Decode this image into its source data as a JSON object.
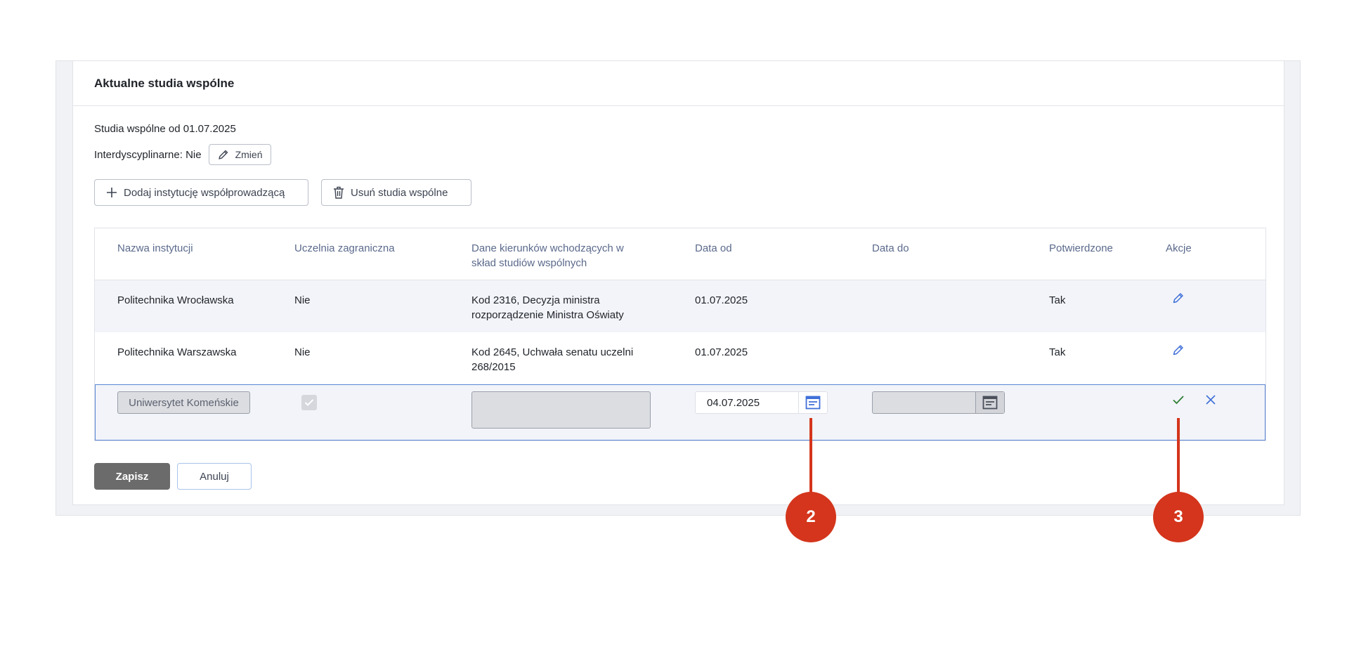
{
  "panel": {
    "title": "Aktualne studia wspólne",
    "since_text": "Studia wspólne od 01.07.2025",
    "interdisciplinary_label": "Interdyscyplinarne: Nie",
    "change_label": "Zmień"
  },
  "toolbar": {
    "add_institution_label": "Dodaj instytucję współprowadzącą",
    "delete_joint_label": "Usuń studia wspólne"
  },
  "table": {
    "headers": {
      "name": "Nazwa instytucji",
      "foreign": "Uczelnia zagraniczna",
      "programs_line1": "Dane kierunków wchodzących w",
      "programs_line2": "skład studiów wspólnych",
      "date_from": "Data od",
      "date_to": "Data do",
      "confirmed": "Potwierdzone",
      "actions": "Akcje"
    },
    "rows": [
      {
        "name": "Politechnika Wrocławska",
        "foreign": "Nie",
        "programs_line1": "Kod 2316, Decyzja ministra",
        "programs_line2": "rozporządzenie Ministra Oświaty",
        "date_from": "01.07.2025",
        "date_to": "",
        "confirmed": "Tak"
      },
      {
        "name": "Politechnika Warszawska",
        "foreign": "Nie",
        "programs_line1": "Kod 2645, Uchwała senatu uczelni",
        "programs_line2": "268/2015",
        "date_from": "01.07.2025",
        "date_to": "",
        "confirmed": "Tak"
      }
    ],
    "edit_row": {
      "institution": "Uniwersytet Komeńskie",
      "foreign_checked": true,
      "date_from": "04.07.2025",
      "date_to": ""
    }
  },
  "footer": {
    "save_label": "Zapisz",
    "cancel_label": "Anuluj"
  },
  "callouts": {
    "first": "2",
    "second": "3"
  },
  "colors": {
    "accent_blue": "#3f6fd8",
    "confirm_green": "#2e7d32",
    "callout_red": "#d4351c",
    "save_gray": "#6b6b6b"
  },
  "icons": {
    "edit": "pencil-icon",
    "add": "plus-icon",
    "delete": "trash-icon",
    "calendar": "calendar-icon",
    "confirm": "check-icon",
    "cancel": "close-icon"
  }
}
